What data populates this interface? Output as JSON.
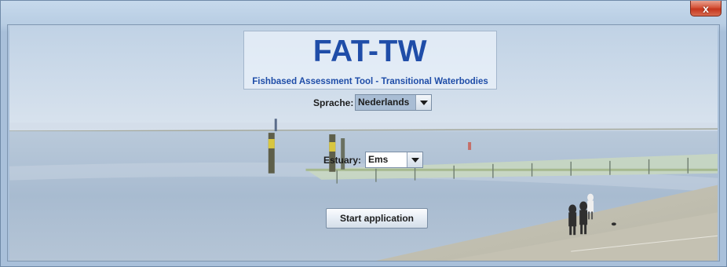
{
  "window": {
    "close_glyph": "x"
  },
  "logo": {
    "title": "FAT-TW",
    "subtitle": "Fishbased Assessment Tool - Transitional Waterbodies"
  },
  "language": {
    "label": "Sprache:",
    "selected": "Nederlands"
  },
  "estuary": {
    "label": "Estuary:",
    "selected": "Ems"
  },
  "start_button": {
    "label": "Start application"
  },
  "icons": {
    "dropdown": "triangle-down-icon"
  },
  "colors": {
    "title_blue": "#1f4da8",
    "selected_language_bg": "#a9bdd4",
    "close_button": "#d5543a"
  }
}
